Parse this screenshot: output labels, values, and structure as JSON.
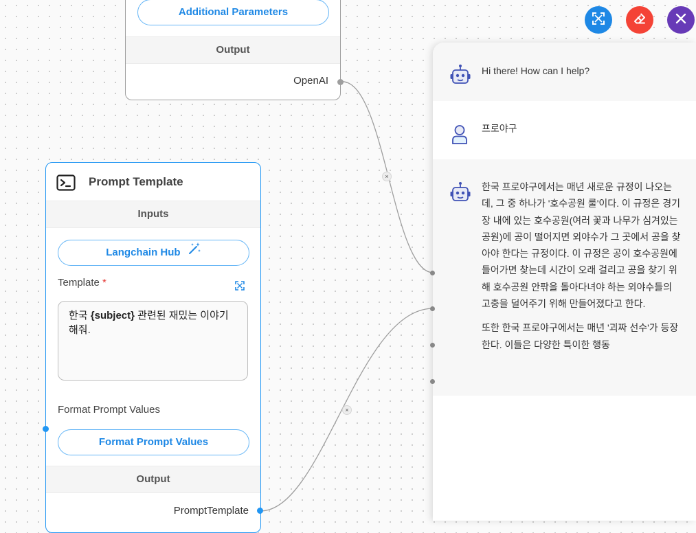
{
  "openai_node": {
    "additional_params_label": "Additional Parameters",
    "output_header": "Output",
    "output_label": "OpenAI"
  },
  "prompt_node": {
    "title": "Prompt Template",
    "inputs_header": "Inputs",
    "langchain_hub_label": "Langchain Hub",
    "template_label": "Template",
    "required_mark": "*",
    "template_text_before": "한국 ",
    "template_var": "{subject}",
    "template_text_after": " 관련된 재밌는 이야기 해줘.",
    "format_values_label": "Format Prompt Values",
    "format_values_button": "Format Prompt Values",
    "output_header": "Output",
    "output_label": "PromptTemplate"
  },
  "toolbar": {
    "expand_icon": "expand-icon",
    "clear_icon": "eraser-icon",
    "close_icon": "close-icon",
    "colors": {
      "expand": "#1e88e5",
      "clear": "#f44336",
      "close": "#673ab7"
    }
  },
  "edges": {
    "delete_glyph": "×"
  },
  "chat": {
    "messages": [
      {
        "role": "bot",
        "text": "Hi there! How can I help?"
      },
      {
        "role": "user",
        "text": "프로야구"
      },
      {
        "role": "bot",
        "paragraphs": [
          "한국 프로야구에서는 매년 새로운 규정이 나오는데, 그 중 하나가 '호수공원 룰'이다. 이 규정은 경기장 내에 있는 호수공원(여러 꽃과 나무가 심겨있는 공원)에 공이 떨어지면 외야수가 그 곳에서 공을 찾아야 한다는 규정이다. 이 규정은 공이 호수공원에 들어가면 찾는데 시간이 오래 걸리고 공을 찾기 위해 호수공원 안팎을 돌아다녀야 하는 외야수들의 고충을 덜어주기 위해 만들어졌다고 한다.",
          "또한 한국 프로야구에서는 매년 '괴짜 선수'가 등장한다. 이들은 다양한 특이한 행동"
        ]
      }
    ]
  }
}
